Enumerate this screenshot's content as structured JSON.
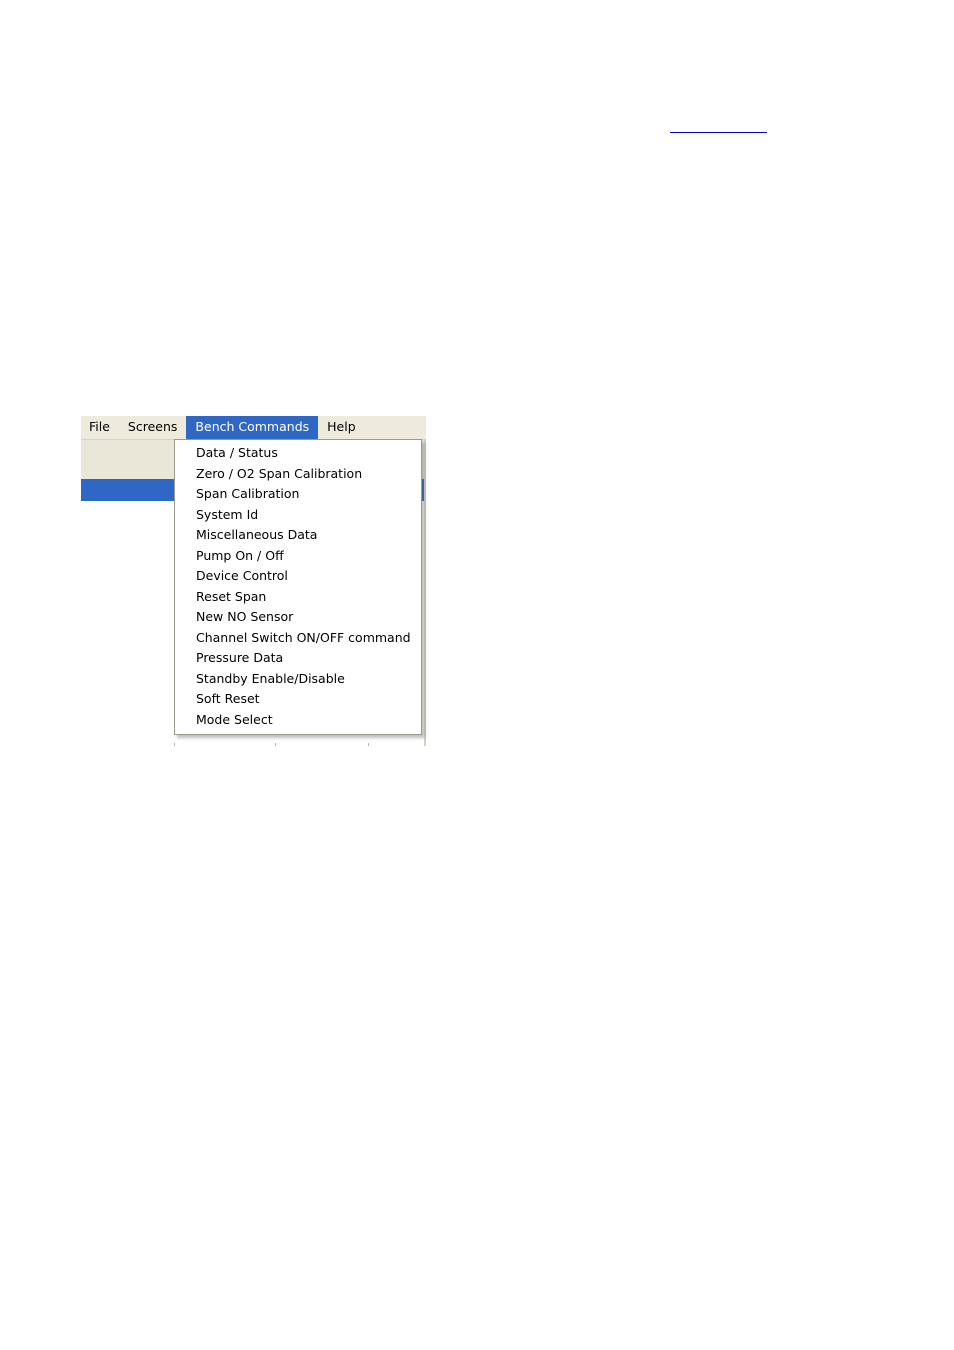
{
  "document": {
    "background_color": "#ffffff",
    "link": {
      "text": "",
      "underline_color": "#0000c8"
    }
  },
  "app": {
    "colors": {
      "menubar_background": "#eeebdd",
      "highlight_blue": "#2e68c4",
      "grid_header_background": "#eae7d9",
      "popup_background": "#ffffff",
      "popup_border": "#9a9a8f"
    },
    "menubar": {
      "items": [
        {
          "label": "File",
          "active": false
        },
        {
          "label": "Screens",
          "active": false
        },
        {
          "label": "Bench Commands",
          "active": true
        },
        {
          "label": "Help",
          "active": false
        }
      ]
    },
    "dropdown": {
      "owner": "Bench Commands",
      "items": [
        {
          "label": "Data / Status"
        },
        {
          "label": "Zero / O2 Span Calibration"
        },
        {
          "label": "Span Calibration"
        },
        {
          "label": "System Id"
        },
        {
          "label": "Miscellaneous Data"
        },
        {
          "label": "Pump On / Off"
        },
        {
          "label": "Device Control"
        },
        {
          "label": "Reset Span"
        },
        {
          "label": "New NO Sensor"
        },
        {
          "label": "Channel Switch ON/OFF command"
        },
        {
          "label": "Pressure Data"
        },
        {
          "label": "Standby Enable/Disable"
        },
        {
          "label": "Soft Reset"
        },
        {
          "label": "Mode Select"
        }
      ]
    },
    "grid": {
      "header_row": "",
      "selected_row": ""
    }
  }
}
